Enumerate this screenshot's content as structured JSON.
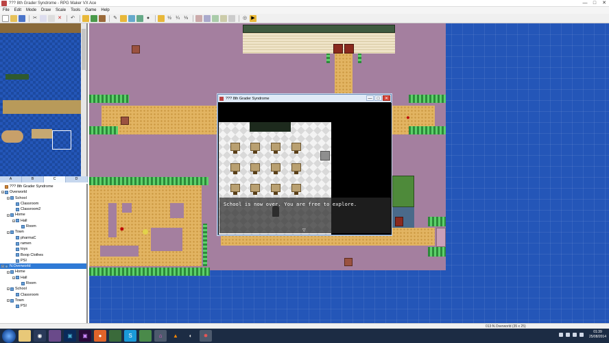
{
  "window": {
    "title": "??? 8th Grader Syndrome - RPG Maker VX Ace",
    "controls": [
      "—",
      "□",
      "✕"
    ]
  },
  "menu": [
    "File",
    "Edit",
    "Mode",
    "Draw",
    "Scale",
    "Tools",
    "Game",
    "Help"
  ],
  "palette_tabs": [
    "A",
    "B",
    "C",
    "D"
  ],
  "palette_active_tab": "C",
  "map_tree": [
    {
      "label": "??? 8th Grader Syndrome",
      "depth": 0,
      "expander": "",
      "kind": "root"
    },
    {
      "label": "Overworld",
      "depth": 0,
      "expander": "−",
      "kind": "map"
    },
    {
      "label": "School",
      "depth": 1,
      "expander": "−",
      "kind": "map"
    },
    {
      "label": "Classroom",
      "depth": 2,
      "expander": "",
      "kind": "map"
    },
    {
      "label": "Classroom2",
      "depth": 2,
      "expander": "",
      "kind": "map"
    },
    {
      "label": "Home",
      "depth": 1,
      "expander": "−",
      "kind": "map"
    },
    {
      "label": "Hall",
      "depth": 2,
      "expander": "−",
      "kind": "map"
    },
    {
      "label": "Room",
      "depth": 3,
      "expander": "",
      "kind": "map"
    },
    {
      "label": "Town",
      "depth": 1,
      "expander": "−",
      "kind": "map"
    },
    {
      "label": "pharmaC",
      "depth": 2,
      "expander": "",
      "kind": "map"
    },
    {
      "label": "ramen",
      "depth": 2,
      "expander": "",
      "kind": "map"
    },
    {
      "label": "toys",
      "depth": 2,
      "expander": "",
      "kind": "map"
    },
    {
      "label": "Boop Clothes",
      "depth": 2,
      "expander": "",
      "kind": "map"
    },
    {
      "label": "PSI",
      "depth": 2,
      "expander": "",
      "kind": "map"
    },
    {
      "label": "N.Overworld",
      "depth": 0,
      "expander": "−",
      "kind": "map",
      "selected": true
    },
    {
      "label": "Home",
      "depth": 1,
      "expander": "−",
      "kind": "map"
    },
    {
      "label": "Hall",
      "depth": 2,
      "expander": "−",
      "kind": "map"
    },
    {
      "label": "Room",
      "depth": 3,
      "expander": "",
      "kind": "map"
    },
    {
      "label": "School",
      "depth": 1,
      "expander": "−",
      "kind": "map"
    },
    {
      "label": "Classroom",
      "depth": 2,
      "expander": "",
      "kind": "map"
    },
    {
      "label": "Town",
      "depth": 1,
      "expander": "−",
      "kind": "map"
    },
    {
      "label": "PSI",
      "depth": 2,
      "expander": "",
      "kind": "map"
    }
  ],
  "game_window": {
    "title": "??? 8th Grader Syndrome",
    "message": "School is now over. You are free to explore.",
    "more_indicator": "▽"
  },
  "status": {
    "map_info": "013:N.Overworld (35 x 25)"
  },
  "clock": {
    "time": "01:39",
    "date": "25/08/2014"
  },
  "colors": {
    "accent": "#2f7ad6",
    "map_water": "#2456b8",
    "ground": "#a47f9f",
    "path": "#e2b462",
    "hedge": "#2c8a3a",
    "taskbar": "#1c2c44"
  }
}
